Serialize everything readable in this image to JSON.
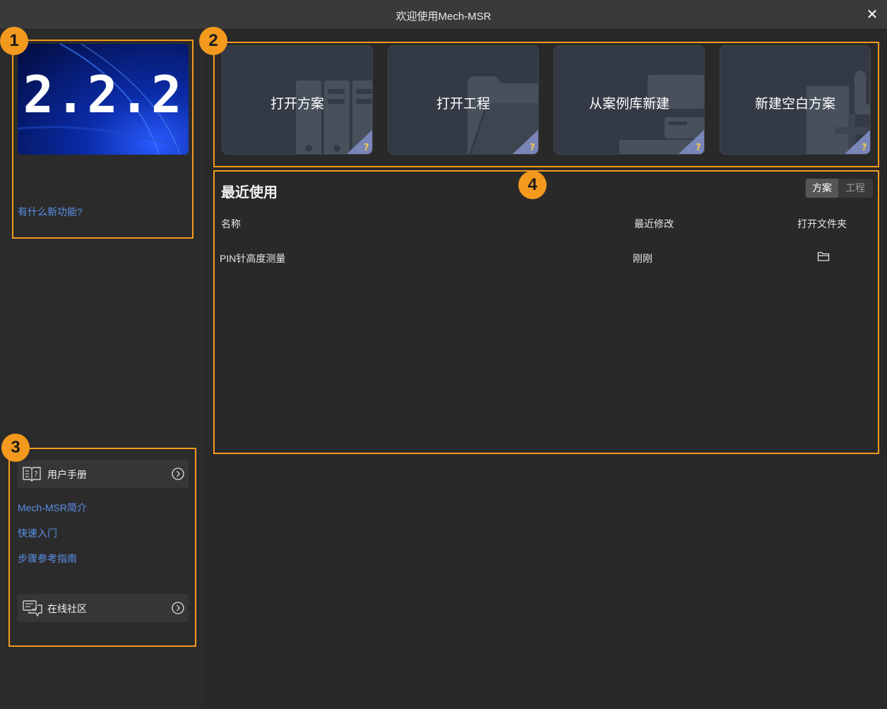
{
  "window": {
    "title": "欢迎使用Mech-MSR",
    "close_glyph": "✕"
  },
  "sidebar": {
    "banner_version": "2.2.2",
    "whats_new": "有什么新功能?",
    "manual_button": {
      "label": "用户手册",
      "icon": "book-icon"
    },
    "links": [
      "Mech-MSR简介",
      "快速入门",
      "步骤参考指南"
    ],
    "community_button": {
      "label": "在线社区",
      "icon": "chat-icon"
    }
  },
  "cards": [
    {
      "label": "打开方案",
      "icon": "folders-bg-icon"
    },
    {
      "label": "打开工程",
      "icon": "folder-bg-icon"
    },
    {
      "label": "从案例库新建",
      "icon": "library-bg-icon"
    },
    {
      "label": "新建空白方案",
      "icon": "new-file-bg-icon"
    }
  ],
  "recent": {
    "title": "最近使用",
    "toggle": {
      "active": "方案",
      "inactive": "工程"
    },
    "columns": {
      "name": "名称",
      "modified": "最近修改",
      "open_folder": "打开文件夹"
    },
    "rows": [
      {
        "name": "PIN针高度测量",
        "modified": "刚刚",
        "folder_icon": "folder-icon"
      }
    ]
  },
  "callouts": [
    "1",
    "2",
    "3",
    "4"
  ],
  "colors": {
    "accent": "#f39a1e",
    "link": "#5b8fe8",
    "help_badge": "#7a86b8"
  }
}
